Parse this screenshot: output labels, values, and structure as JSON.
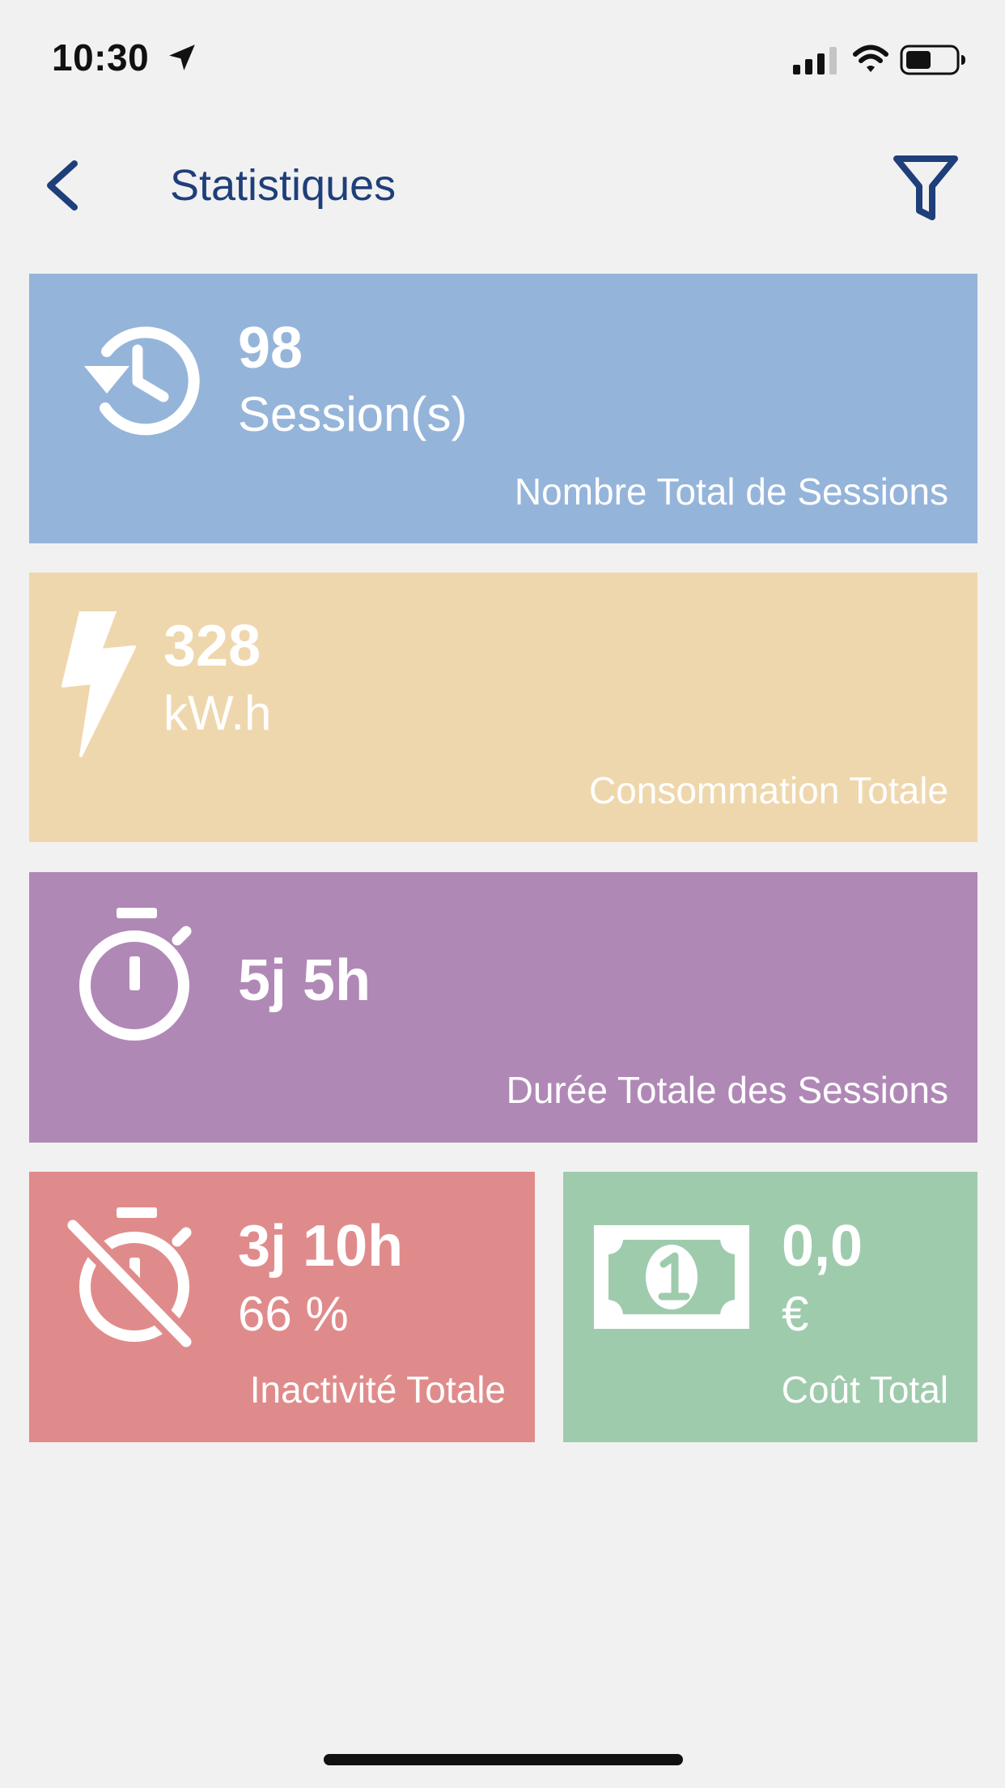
{
  "status_bar": {
    "time": "10:30",
    "icons": [
      "location-arrow-icon",
      "signal-icon",
      "wifi-icon",
      "battery-icon"
    ]
  },
  "header": {
    "title": "Statistiques",
    "back_icon": "chevron-left-icon",
    "filter_icon": "filter-icon",
    "accent_color": "#1e3f7a"
  },
  "cards": {
    "sessions": {
      "value": "98",
      "unit": "Session(s)",
      "label": "Nombre Total de Sessions",
      "icon": "history-icon",
      "color": "#95b4da"
    },
    "energy": {
      "value": "328",
      "unit": "kW.h",
      "label": "Consommation Totale",
      "icon": "lightning-bolt-icon",
      "color": "#efd7ad"
    },
    "duration": {
      "value": "5j 5h",
      "label": "Durée Totale des Sessions",
      "icon": "stopwatch-icon",
      "color": "#b088b6"
    },
    "idle": {
      "value": "3j 10h",
      "unit": "66 %",
      "label": "Inactivité Totale",
      "icon": "stopwatch-off-icon",
      "color": "#e08b8b"
    },
    "cost": {
      "value": "0,0",
      "unit": "€",
      "label": "Coût Total",
      "icon": "banknote-icon",
      "color": "#9fcbad"
    }
  }
}
